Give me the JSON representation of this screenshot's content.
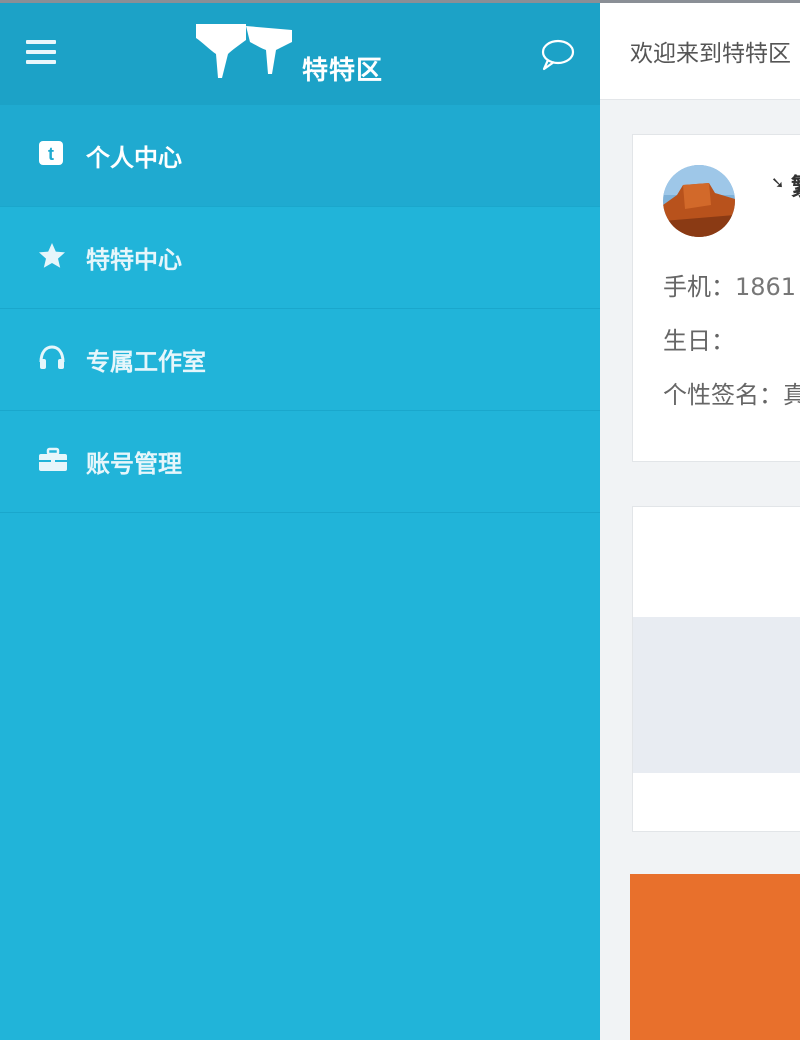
{
  "main": {
    "welcome_text": "欢迎来到特特区",
    "profile": {
      "name_fragment": "繁",
      "phone_label": "手机：",
      "phone_value": "1861",
      "birthday_label": "生日：",
      "signature_label": "个性签名：",
      "signature_fragment": "真"
    }
  },
  "drawer": {
    "brand": "特特区",
    "menu": [
      {
        "label": "个人中心",
        "icon": "tumblr-t-icon"
      },
      {
        "label": "特特中心",
        "icon": "star-icon"
      },
      {
        "label": "专属工作室",
        "icon": "headphones-icon"
      },
      {
        "label": "账号管理",
        "icon": "briefcase-icon"
      }
    ]
  },
  "colors": {
    "drawer_bg": "#21b4d9",
    "drawer_header": "#1ca2c7",
    "active_item": "#1faad0",
    "accent_orange": "#e8702c"
  }
}
